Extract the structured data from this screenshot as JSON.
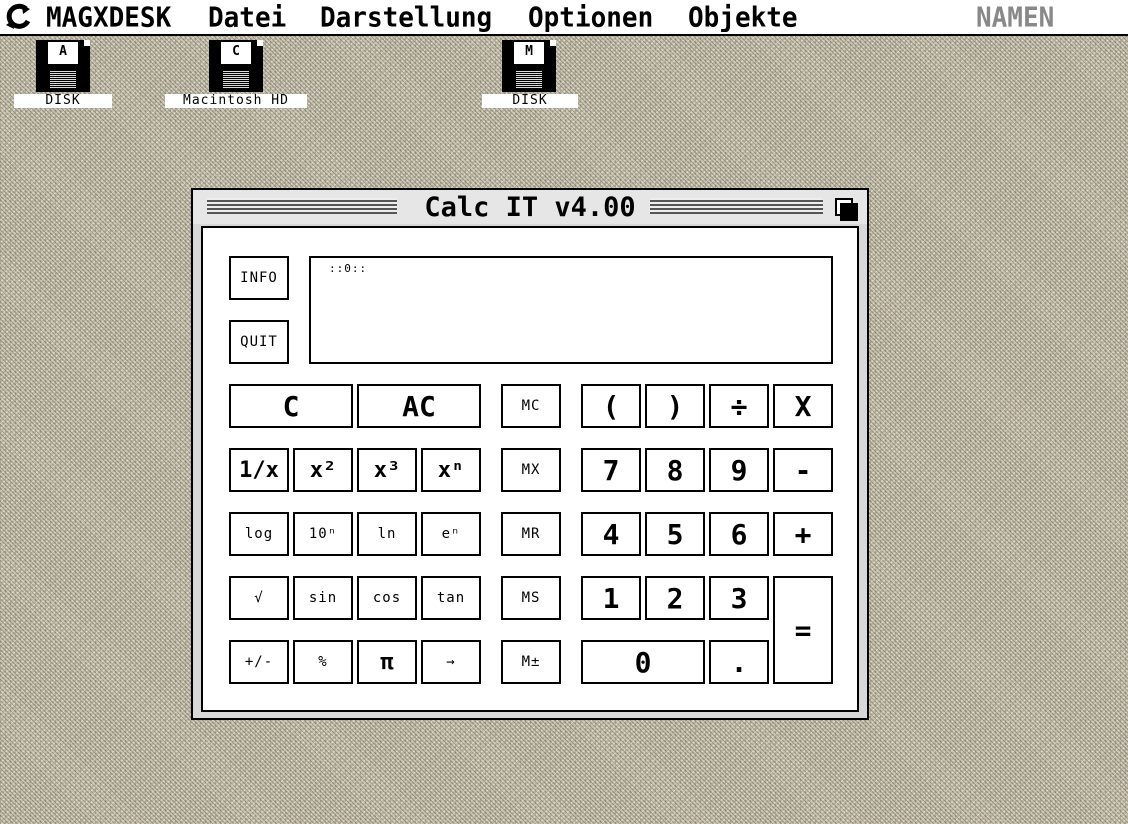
{
  "menubar": {
    "app": "MAGXDESK",
    "items": [
      "Datei",
      "Darstellung",
      "Optionen",
      "Objekte"
    ],
    "right": "NAMEN"
  },
  "desktop": {
    "icons": [
      {
        "letter": "A",
        "label": "DISK"
      },
      {
        "letter": "C",
        "label": "Macintosh HD"
      },
      {
        "letter": "M",
        "label": "DISK"
      }
    ]
  },
  "window": {
    "title": "Calc IT v4.00"
  },
  "calc": {
    "display": "::0::",
    "info": "INFO",
    "quit": "QUIT",
    "keys": {
      "c": "C",
      "ac": "AC",
      "recip": "1/x",
      "sq": "x²",
      "cube": "x³",
      "pow": "xⁿ",
      "log": "log",
      "tenpow": "10ⁿ",
      "ln": "ln",
      "epow": "eⁿ",
      "sqrt": "√",
      "sin": "sin",
      "cos": "cos",
      "tan": "tan",
      "neg": "+/-",
      "pct": "%",
      "pi": "π",
      "arrow": "→",
      "mc": "MC",
      "mx": "MX",
      "mr": "MR",
      "ms": "MS",
      "mpm": "M±",
      "lparen": "(",
      "rparen": ")",
      "div": "÷",
      "mul": "X",
      "d7": "7",
      "d8": "8",
      "d9": "9",
      "minus": "-",
      "d4": "4",
      "d5": "5",
      "d6": "6",
      "plus": "+",
      "d1": "1",
      "d2": "2",
      "d3": "3",
      "eq": "=",
      "d0": "0",
      "dot": "."
    }
  }
}
